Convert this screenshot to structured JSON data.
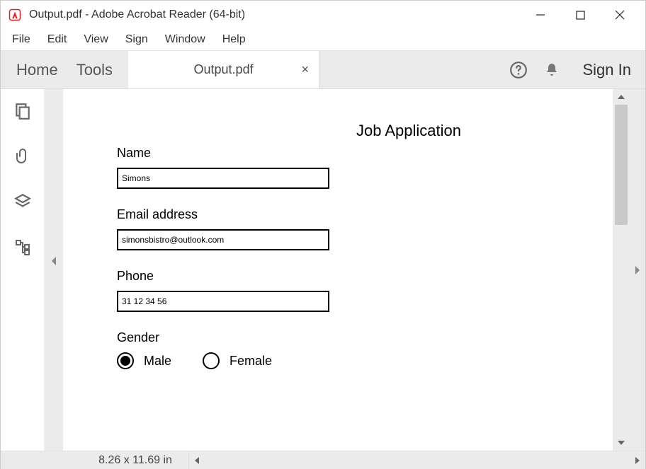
{
  "window": {
    "title": "Output.pdf - Adobe Acrobat Reader (64-bit)"
  },
  "menu": {
    "file": "File",
    "edit": "Edit",
    "view": "View",
    "sign": "Sign",
    "window": "Window",
    "help": "Help"
  },
  "tabs": {
    "home": "Home",
    "tools": "Tools",
    "document": "Output.pdf",
    "signin": "Sign In"
  },
  "document": {
    "title": "Job Application",
    "fields": {
      "name_label": "Name",
      "name_value": "Simons",
      "email_label": "Email address",
      "email_value": "simonsbistro@outlook.com",
      "phone_label": "Phone",
      "phone_value": "31 12 34 56",
      "gender_label": "Gender",
      "gender_male": "Male",
      "gender_female": "Female",
      "gender_selected": "male"
    }
  },
  "status": {
    "dimensions": "8.26 x 11.69 in"
  }
}
